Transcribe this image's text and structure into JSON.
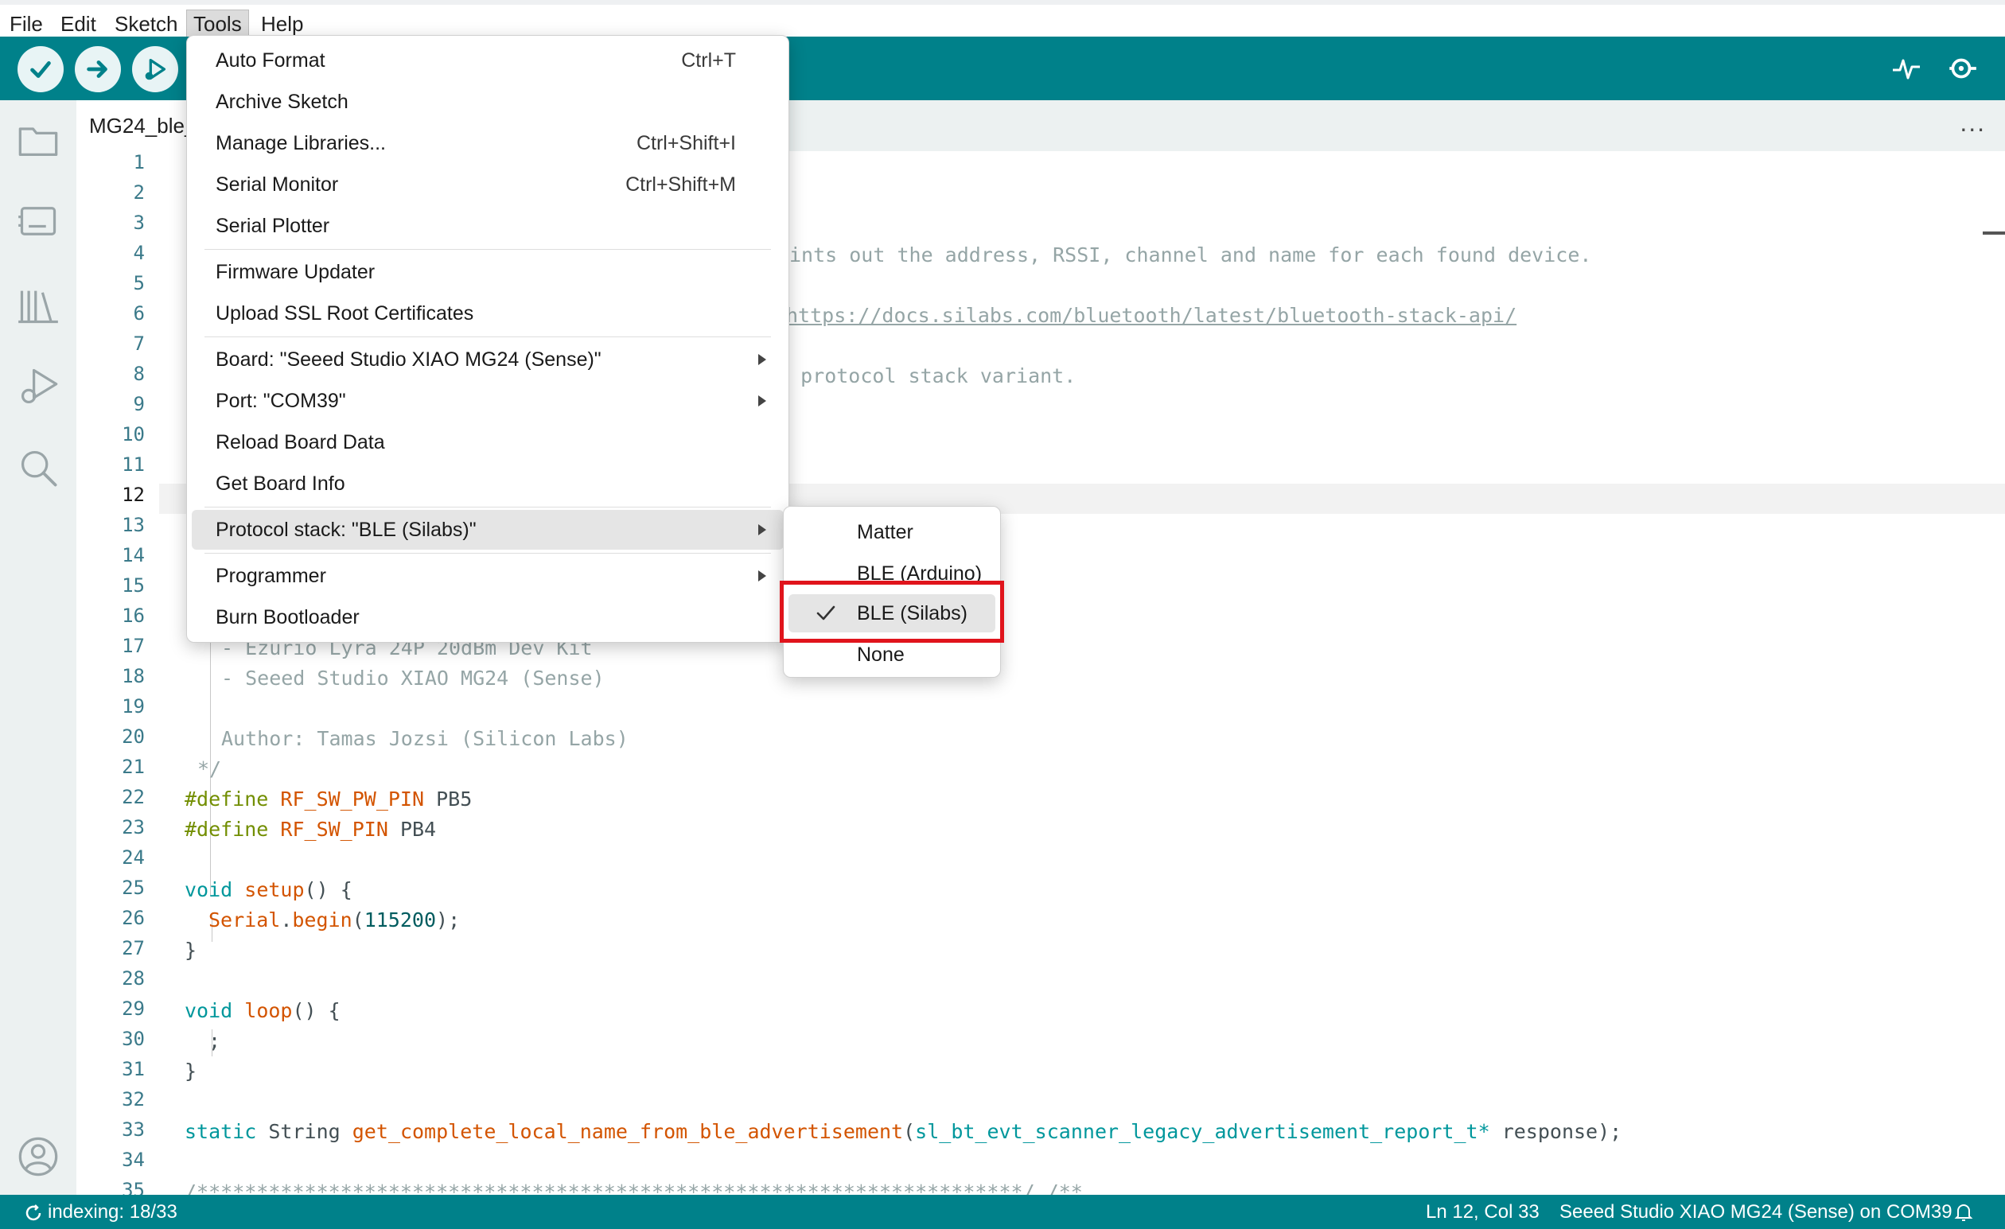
{
  "menubar": {
    "items": [
      "File",
      "Edit",
      "Sketch",
      "Tools",
      "Help"
    ],
    "active": "Tools"
  },
  "toolbar": {
    "verify_icon": "checkmark-icon",
    "upload_icon": "arrow-right-icon",
    "debug_icon": "debug-play-icon",
    "plotter_icon": "serial-plotter-icon",
    "monitor_icon": "serial-monitor-icon"
  },
  "sidebar": {
    "icons": [
      "folder-icon",
      "board-icon",
      "library-icon",
      "debug-icon",
      "search-icon",
      "account-icon"
    ]
  },
  "tab": {
    "label": "MG24_ble_",
    "more": "..."
  },
  "editor": {
    "line_numbers": [
      "1",
      "2",
      "3",
      "4",
      "5",
      "6",
      "7",
      "8",
      "9",
      "10",
      "11",
      "12",
      "13",
      "14",
      "15",
      "16",
      "17",
      "18",
      "19",
      "20",
      "21",
      "22",
      "23",
      "24",
      "25",
      "26",
      "27",
      "28",
      "29",
      "30",
      "31",
      "32",
      "33",
      "34",
      "35"
    ],
    "current_line": "12",
    "code": {
      "l4": "ints out the address, RSSI, channel and name for each found device.",
      "l6": "https://docs.silabs.com/bluetooth/latest/bluetooth-stack-api/",
      "l8": "' protocol stack variant.",
      "l17": "- Ezurio Lyra 24P 20dBm Dev Kit",
      "l18": "- Seeed Studio XIAO MG24 (Sense)",
      "l20": "Author: Tamas Jozsi (Silicon Labs)",
      "l21": "*/",
      "l22_kw": "#define",
      "l22_name": "RF_SW_PW_PIN",
      "l22_val": "PB5",
      "l23_kw": "#define",
      "l23_name": "RF_SW_PIN",
      "l23_val": "PB4",
      "l25_kw": "void",
      "l25_fn": "setup",
      "l25_rest": "() {",
      "l26_obj": "Serial",
      "l26_dot": ".",
      "l26_fn": "begin",
      "l26_open": "(",
      "l26_num": "115200",
      "l26_close": ");",
      "l27": "}",
      "l29_kw": "void",
      "l29_fn": "loop",
      "l29_rest": "() {",
      "l30": ";",
      "l31": "}",
      "l33_kw": "static",
      "l33_type": "String",
      "l33_fn": "get_complete_local_name_from_ble_advertisement",
      "l33_open": "(",
      "l33_ptype": "sl_bt_evt_scanner_legacy_advertisement_report_t*",
      "l33_rest": "response);",
      "l35": "/*********************************************************************/ /**"
    }
  },
  "tools_menu": {
    "auto_format": "Auto Format",
    "auto_format_sc": "Ctrl+T",
    "archive_sketch": "Archive Sketch",
    "manage_libraries": "Manage Libraries...",
    "manage_libraries_sc": "Ctrl+Shift+I",
    "serial_monitor": "Serial Monitor",
    "serial_monitor_sc": "Ctrl+Shift+M",
    "serial_plotter": "Serial Plotter",
    "firmware_updater": "Firmware Updater",
    "upload_ssl": "Upload SSL Root Certificates",
    "board": "Board: \"Seeed Studio XIAO MG24 (Sense)\"",
    "port": "Port: \"COM39\"",
    "reload_board": "Reload Board Data",
    "get_board_info": "Get Board Info",
    "protocol_stack": "Protocol stack: \"BLE (Silabs)\"",
    "programmer": "Programmer",
    "burn_bootloader": "Burn Bootloader"
  },
  "protocol_submenu": {
    "items": [
      "Matter",
      "BLE (Arduino)",
      "BLE (Silabs)",
      "None"
    ],
    "selected": "BLE (Silabs)",
    "check_icon": "checkmark-icon"
  },
  "statusbar": {
    "indexing": "indexing: 18/33",
    "position": "Ln 12, Col 33",
    "board_port": "Seeed Studio XIAO MG24 (Sense) on COM39",
    "bell_icon": "notification-bell-icon"
  },
  "colors": {
    "accent": "#00818a",
    "highlight_box": "#e0141c"
  }
}
